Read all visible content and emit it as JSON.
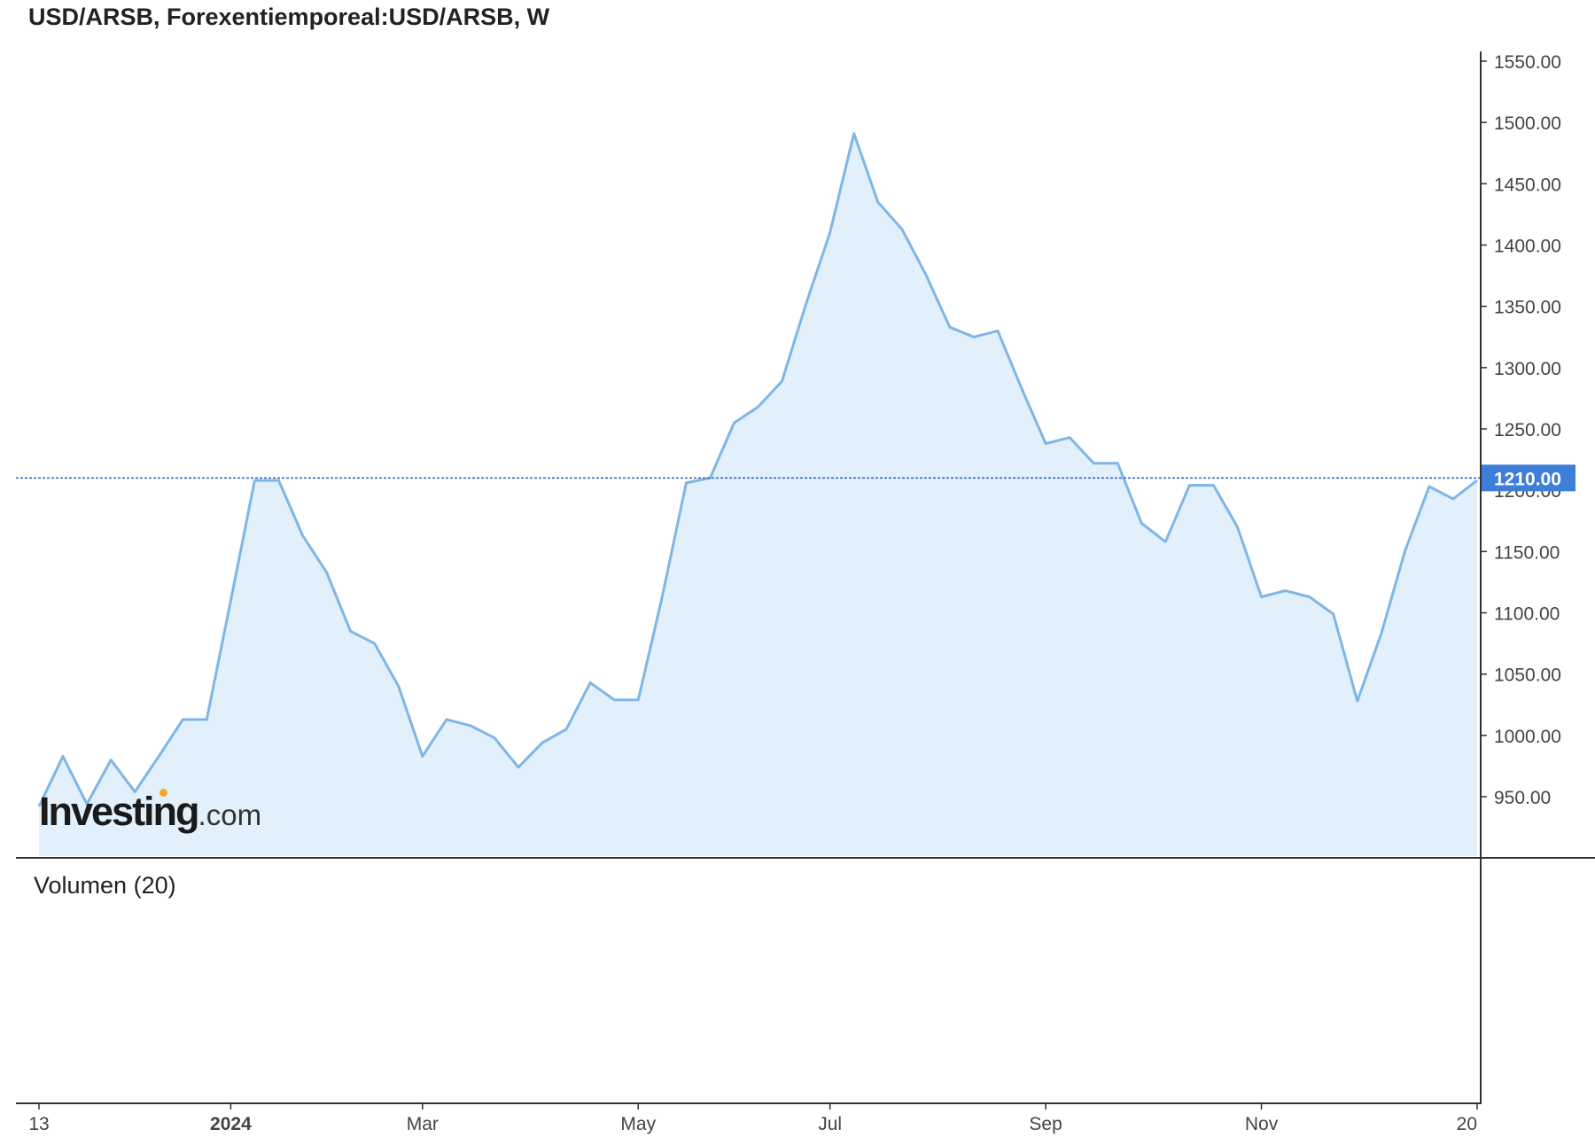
{
  "header": {
    "title": "USD/ARSB, Forexentiemporeal:USD/ARSB, W"
  },
  "volume": {
    "label": "Volumen (20)"
  },
  "logo": {
    "main": "Investing",
    "suffix": ".com"
  },
  "colors": {
    "line": "#7fb6e6",
    "fill": "#e1f0fa",
    "current_price_bg": "#3d7fd8",
    "current_price_line": "#2f5fb3",
    "axis": "#333333",
    "logo_dot": "#f5a623"
  },
  "chart_data": {
    "type": "area",
    "title": "USD/ARSB, Forexentiemporeal:USD/ARSB, W",
    "xlabel": "",
    "ylabel": "",
    "ylim": [
      890,
      1550
    ],
    "y_ticks": [
      "1550.00",
      "1500.00",
      "1450.00",
      "1400.00",
      "1350.00",
      "1300.00",
      "1250.00",
      "1200.00",
      "1150.00",
      "1100.00",
      "1050.00",
      "1000.00",
      "950.00"
    ],
    "y_tick_values": [
      1550,
      1500,
      1450,
      1400,
      1350,
      1300,
      1250,
      1200,
      1150,
      1100,
      1050,
      1000,
      950
    ],
    "x_ticks": [
      {
        "label": "13",
        "index": 0,
        "bold": false
      },
      {
        "label": "2024",
        "index": 8,
        "bold": true
      },
      {
        "label": "Mar",
        "index": 16,
        "bold": false
      },
      {
        "label": "May",
        "index": 25,
        "bold": false
      },
      {
        "label": "Jul",
        "index": 33,
        "bold": false
      },
      {
        "label": "Sep",
        "index": 42,
        "bold": false
      },
      {
        "label": "Nov",
        "index": 51,
        "bold": false
      },
      {
        "label": "20",
        "index": 60,
        "bold": false
      }
    ],
    "current_value": 1210.0,
    "current_label": "1210.00",
    "series": [
      {
        "values": [
          942,
          983,
          944,
          980,
          954,
          983,
          1013,
          1013,
          1110,
          1208,
          1208,
          1163,
          1133,
          1085,
          1075,
          1040,
          983,
          1013,
          1008,
          998,
          974,
          994,
          1005,
          1043,
          1029,
          1029,
          1113,
          1206,
          1210,
          1255,
          1268,
          1289,
          1352,
          1410,
          1491,
          1435,
          1413,
          1376,
          1333,
          1325,
          1330,
          1283,
          1238,
          1243,
          1222,
          1222,
          1173,
          1158,
          1204,
          1204,
          1170,
          1113,
          1118,
          1113,
          1099,
          1028,
          1083,
          1151,
          1203,
          1193,
          1208
        ]
      }
    ]
  }
}
